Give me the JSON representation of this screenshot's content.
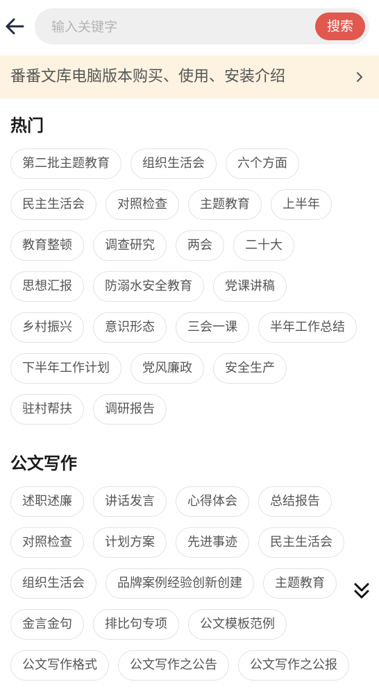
{
  "search": {
    "placeholder": "输入关键字",
    "button_label": "搜索"
  },
  "banner": {
    "text": "番番文库电脑版本购买、使用、安装介绍"
  },
  "hot": {
    "title": "热门",
    "tags": [
      "第二批主题教育",
      "组织生活会",
      "六个方面",
      "民主生活会",
      "对照检查",
      "主题教育",
      "上半年",
      "教育整顿",
      "调查研究",
      "两会",
      "二十大",
      "思想汇报",
      "防溺水安全教育",
      "党课讲稿",
      "乡村振兴",
      "意识形态",
      "三会一课",
      "半年工作总结",
      "下半年工作计划",
      "党风廉政",
      "安全生产",
      "驻村帮扶",
      "调研报告"
    ]
  },
  "writing": {
    "title": "公文写作",
    "tags": [
      "述职述廉",
      "讲话发言",
      "心得体会",
      "总结报告",
      "对照检查",
      "计划方案",
      "先进事迹",
      "民主生活会",
      "组织生活会",
      "品牌案例经验创新创建",
      "主题教育",
      "金言金句",
      "排比句专项",
      "公文模板范例",
      "公文写作格式",
      "公文写作之公告",
      "公文写作之公报"
    ]
  },
  "icons": {
    "back": "arrow-left-icon",
    "banner": "chevron-right-icon",
    "expand": "double-chevron-down-icon"
  },
  "colors": {
    "accent": "#e0584e",
    "banner_bg": "#fdf3e0"
  }
}
